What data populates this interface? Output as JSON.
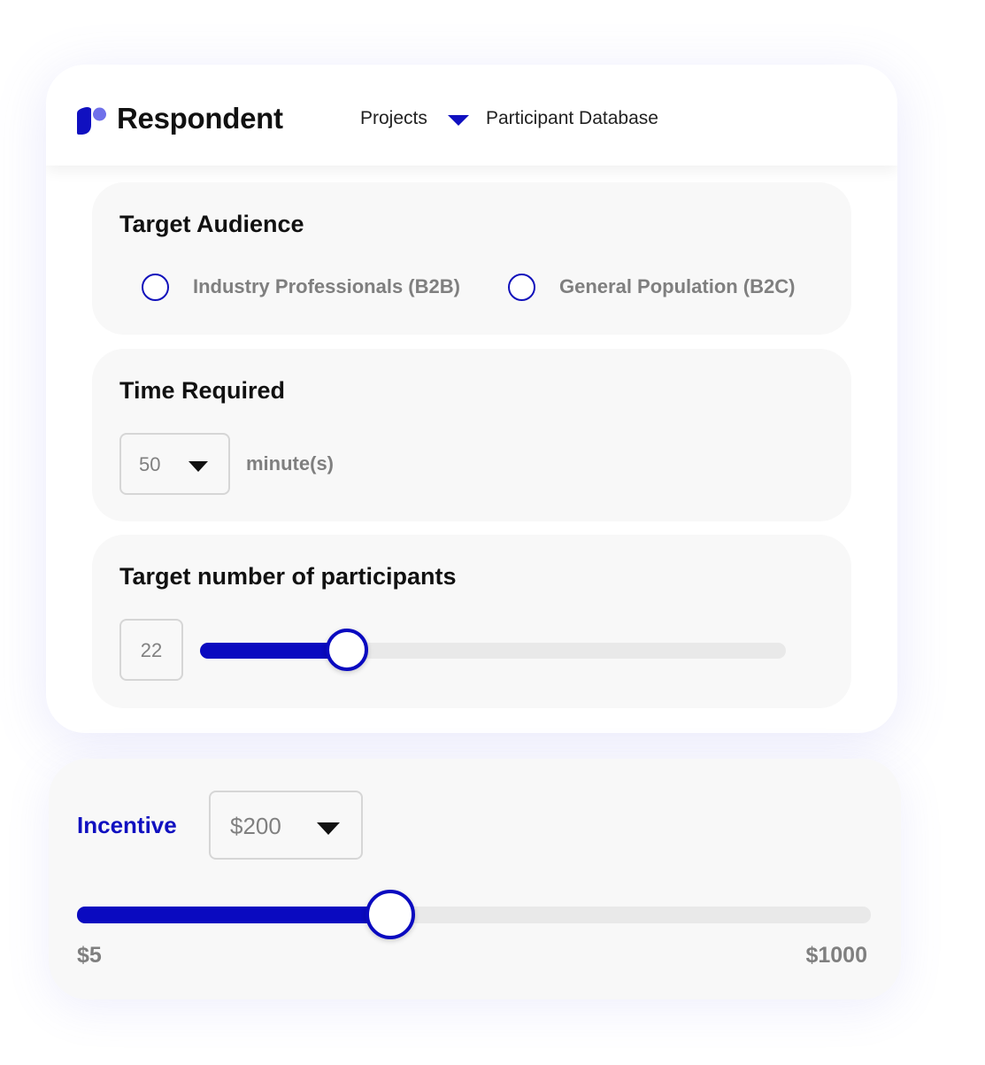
{
  "header": {
    "brand": "Respondent",
    "nav_projects": "Projects",
    "nav_participant_db": "Participant Database",
    "brand_color": "#1010c0"
  },
  "target_audience": {
    "title": "Target Audience",
    "options": [
      {
        "label": "Industry Professionals (B2B)",
        "selected": false
      },
      {
        "label": "General Population (B2C)",
        "selected": false
      }
    ]
  },
  "time_required": {
    "title": "Time Required",
    "value": "50",
    "unit": "minute(s)"
  },
  "participants": {
    "title": "Target number of participants",
    "value": "22",
    "slider_fraction": 0.25
  },
  "incentive": {
    "label": "Incentive",
    "value": "$200",
    "slider_fraction": 0.395,
    "min_label": "$5",
    "max_label": "$1000"
  },
  "icons": {
    "logo": "respondent-logo-icon",
    "dropdown": "caret-down-icon"
  }
}
